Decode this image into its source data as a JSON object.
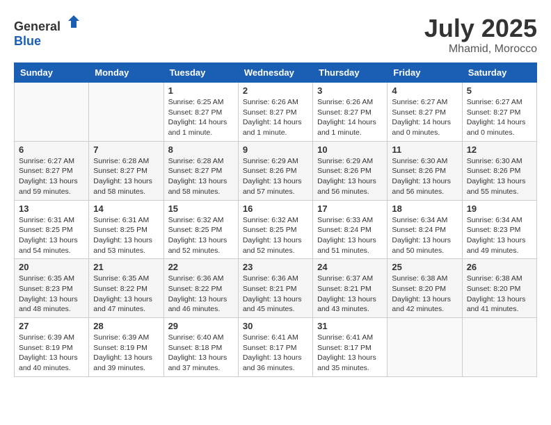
{
  "header": {
    "logo_general": "General",
    "logo_blue": "Blue",
    "month": "July 2025",
    "location": "Mhamid, Morocco"
  },
  "days_of_week": [
    "Sunday",
    "Monday",
    "Tuesday",
    "Wednesday",
    "Thursday",
    "Friday",
    "Saturday"
  ],
  "weeks": [
    [
      {
        "day": null
      },
      {
        "day": null
      },
      {
        "day": "1",
        "sunrise": "6:25 AM",
        "sunset": "8:27 PM",
        "daylight": "14 hours and 1 minute."
      },
      {
        "day": "2",
        "sunrise": "6:26 AM",
        "sunset": "8:27 PM",
        "daylight": "14 hours and 1 minute."
      },
      {
        "day": "3",
        "sunrise": "6:26 AM",
        "sunset": "8:27 PM",
        "daylight": "14 hours and 1 minute."
      },
      {
        "day": "4",
        "sunrise": "6:27 AM",
        "sunset": "8:27 PM",
        "daylight": "14 hours and 0 minutes."
      },
      {
        "day": "5",
        "sunrise": "6:27 AM",
        "sunset": "8:27 PM",
        "daylight": "14 hours and 0 minutes."
      }
    ],
    [
      {
        "day": "6",
        "sunrise": "6:27 AM",
        "sunset": "8:27 PM",
        "daylight": "13 hours and 59 minutes."
      },
      {
        "day": "7",
        "sunrise": "6:28 AM",
        "sunset": "8:27 PM",
        "daylight": "13 hours and 58 minutes."
      },
      {
        "day": "8",
        "sunrise": "6:28 AM",
        "sunset": "8:27 PM",
        "daylight": "13 hours and 58 minutes."
      },
      {
        "day": "9",
        "sunrise": "6:29 AM",
        "sunset": "8:26 PM",
        "daylight": "13 hours and 57 minutes."
      },
      {
        "day": "10",
        "sunrise": "6:29 AM",
        "sunset": "8:26 PM",
        "daylight": "13 hours and 56 minutes."
      },
      {
        "day": "11",
        "sunrise": "6:30 AM",
        "sunset": "8:26 PM",
        "daylight": "13 hours and 56 minutes."
      },
      {
        "day": "12",
        "sunrise": "6:30 AM",
        "sunset": "8:26 PM",
        "daylight": "13 hours and 55 minutes."
      }
    ],
    [
      {
        "day": "13",
        "sunrise": "6:31 AM",
        "sunset": "8:25 PM",
        "daylight": "13 hours and 54 minutes."
      },
      {
        "day": "14",
        "sunrise": "6:31 AM",
        "sunset": "8:25 PM",
        "daylight": "13 hours and 53 minutes."
      },
      {
        "day": "15",
        "sunrise": "6:32 AM",
        "sunset": "8:25 PM",
        "daylight": "13 hours and 52 minutes."
      },
      {
        "day": "16",
        "sunrise": "6:32 AM",
        "sunset": "8:25 PM",
        "daylight": "13 hours and 52 minutes."
      },
      {
        "day": "17",
        "sunrise": "6:33 AM",
        "sunset": "8:24 PM",
        "daylight": "13 hours and 51 minutes."
      },
      {
        "day": "18",
        "sunrise": "6:34 AM",
        "sunset": "8:24 PM",
        "daylight": "13 hours and 50 minutes."
      },
      {
        "day": "19",
        "sunrise": "6:34 AM",
        "sunset": "8:23 PM",
        "daylight": "13 hours and 49 minutes."
      }
    ],
    [
      {
        "day": "20",
        "sunrise": "6:35 AM",
        "sunset": "8:23 PM",
        "daylight": "13 hours and 48 minutes."
      },
      {
        "day": "21",
        "sunrise": "6:35 AM",
        "sunset": "8:22 PM",
        "daylight": "13 hours and 47 minutes."
      },
      {
        "day": "22",
        "sunrise": "6:36 AM",
        "sunset": "8:22 PM",
        "daylight": "13 hours and 46 minutes."
      },
      {
        "day": "23",
        "sunrise": "6:36 AM",
        "sunset": "8:21 PM",
        "daylight": "13 hours and 45 minutes."
      },
      {
        "day": "24",
        "sunrise": "6:37 AM",
        "sunset": "8:21 PM",
        "daylight": "13 hours and 43 minutes."
      },
      {
        "day": "25",
        "sunrise": "6:38 AM",
        "sunset": "8:20 PM",
        "daylight": "13 hours and 42 minutes."
      },
      {
        "day": "26",
        "sunrise": "6:38 AM",
        "sunset": "8:20 PM",
        "daylight": "13 hours and 41 minutes."
      }
    ],
    [
      {
        "day": "27",
        "sunrise": "6:39 AM",
        "sunset": "8:19 PM",
        "daylight": "13 hours and 40 minutes."
      },
      {
        "day": "28",
        "sunrise": "6:39 AM",
        "sunset": "8:19 PM",
        "daylight": "13 hours and 39 minutes."
      },
      {
        "day": "29",
        "sunrise": "6:40 AM",
        "sunset": "8:18 PM",
        "daylight": "13 hours and 37 minutes."
      },
      {
        "day": "30",
        "sunrise": "6:41 AM",
        "sunset": "8:17 PM",
        "daylight": "13 hours and 36 minutes."
      },
      {
        "day": "31",
        "sunrise": "6:41 AM",
        "sunset": "8:17 PM",
        "daylight": "13 hours and 35 minutes."
      },
      {
        "day": null
      },
      {
        "day": null
      }
    ]
  ],
  "labels": {
    "sunrise": "Sunrise:",
    "sunset": "Sunset:",
    "daylight": "Daylight:"
  }
}
